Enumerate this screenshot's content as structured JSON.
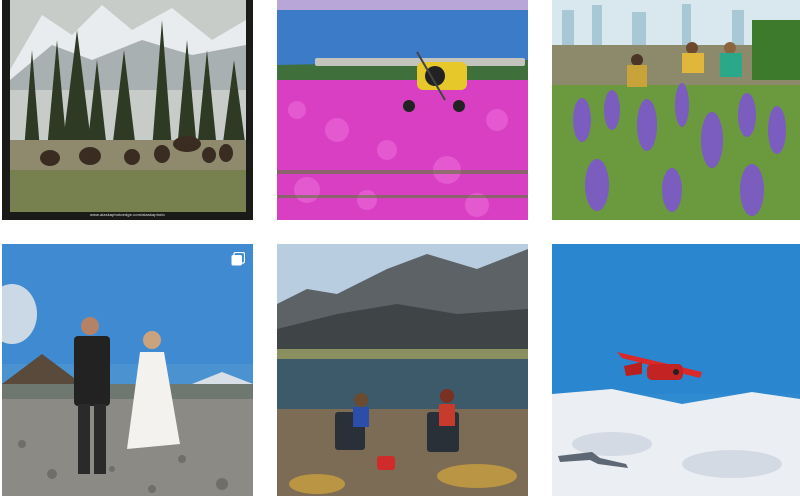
{
  "grid": {
    "posts": [
      {
        "id": "bison",
        "watermark": "www.alaskaphotoedge.com/alaskaphoto"
      },
      {
        "id": "bush-plane-fireweed"
      },
      {
        "id": "glacier-lupines"
      },
      {
        "id": "wedding-couple",
        "badge_icon": "carousel-multiple-icon"
      },
      {
        "id": "lake-camp"
      },
      {
        "id": "red-plane-aerial"
      }
    ]
  }
}
